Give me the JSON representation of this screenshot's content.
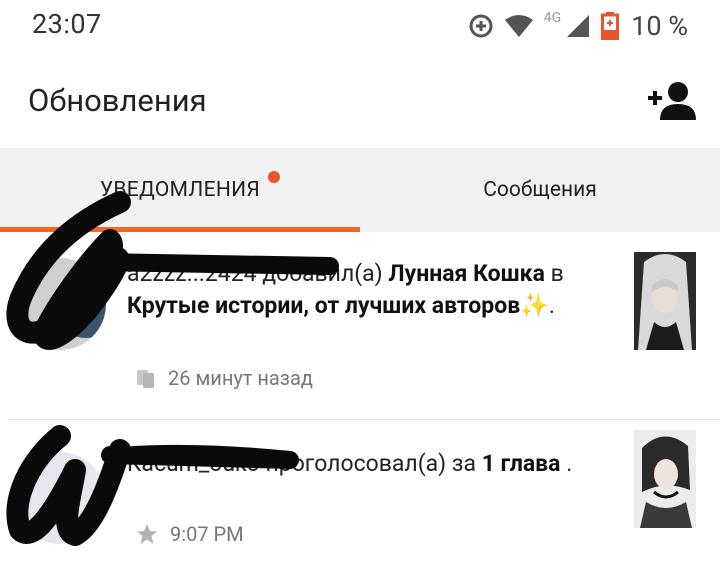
{
  "status_bar": {
    "time": "23:07",
    "network_label": "4G",
    "battery_percent": "10 %",
    "icons": [
      "data-saver-icon",
      "wifi-icon",
      "signal-icon",
      "battery-icon"
    ]
  },
  "header": {
    "title": "Обновления",
    "action_icon": "add-user-icon"
  },
  "tabs": [
    {
      "label": "УВЕДОМЛЕНИЯ",
      "active": true,
      "has_badge": true
    },
    {
      "label": "Сообщения",
      "active": false,
      "has_badge": false
    }
  ],
  "colors": {
    "accent": "#f26722",
    "badge": "#e8542c",
    "tab_bg": "#f2f2f2"
  },
  "notifications": [
    {
      "username_redacted": "a2zzz...2424",
      "action": "добавил(а)",
      "story": "Лунная Кошка",
      "connector": "в",
      "list_name": "Крутые истории, от лучших авторов✨",
      "punct": ".",
      "meta_icon": "copy-icon",
      "time": "26 минут назад"
    },
    {
      "username_redacted": "Kacum_ouko",
      "action": "проголосовал(а) за",
      "chapter": "1 глава",
      "punct": ".",
      "meta_icon": "star-icon",
      "time": "9:07 PM"
    }
  ]
}
